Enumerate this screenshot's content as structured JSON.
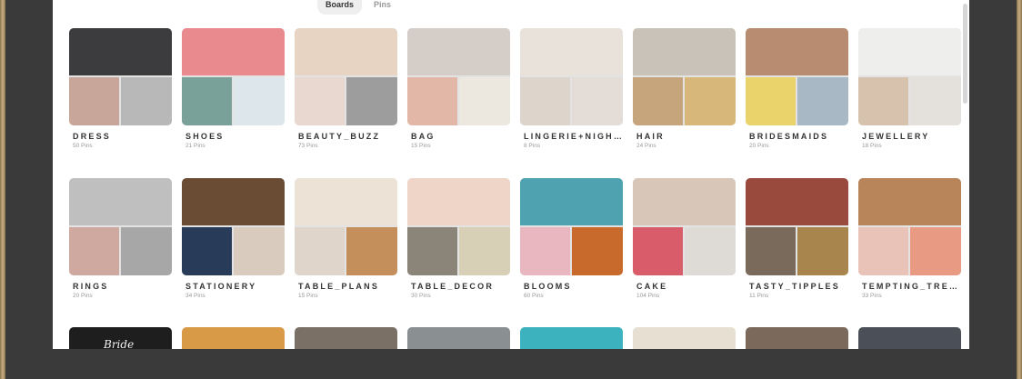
{
  "tabs": [
    {
      "label": "Boards",
      "active": true
    },
    {
      "label": "Pins",
      "active": false
    }
  ],
  "boards": [
    {
      "title": "DRESS",
      "count": "50 Pins",
      "colors": [
        "#3c3c3e",
        "#c9a69a",
        "#b8b8b8"
      ]
    },
    {
      "title": "SHOES",
      "count": "21 Pins",
      "colors": [
        "#e98a8f",
        "#7aa09a",
        "#dde6ea"
      ]
    },
    {
      "title": "BEAUTY_BUZZ",
      "count": "73 Pins",
      "colors": [
        "#e7d4c3",
        "#e8d8cf",
        "#9d9d9d"
      ]
    },
    {
      "title": "BAG",
      "count": "15 Pins",
      "colors": [
        "#d4cdc8",
        "#e2b7a7",
        "#ece7df"
      ]
    },
    {
      "title": "LINGERIE+NIGH…",
      "count": "8 Pins",
      "colors": [
        "#e9e2db",
        "#ddd5cc",
        "#e4ddd7"
      ]
    },
    {
      "title": "HAIR",
      "count": "24 Pins",
      "colors": [
        "#c9c2b9",
        "#c7a57c",
        "#d8b77b"
      ]
    },
    {
      "title": "BRIDESMAIDS",
      "count": "20 Pins",
      "colors": [
        "#b78c71",
        "#e9d36a",
        "#a8b8c4"
      ]
    },
    {
      "title": "JEWELLERY",
      "count": "18 Pins",
      "colors": [
        "#eeeeec",
        "#d7c2ae",
        "#e4e0dc"
      ]
    },
    {
      "title": "RINGS",
      "count": "20 Pins",
      "colors": [
        "#bfbfbf",
        "#cfa8a0",
        "#a7a7a7"
      ]
    },
    {
      "title": "STATIONERY",
      "count": "34 Pins",
      "colors": [
        "#6a4b34",
        "#283b59",
        "#d9cbbe"
      ]
    },
    {
      "title": "TABLE_PLANS",
      "count": "15 Pins",
      "colors": [
        "#ece2d6",
        "#dfd5cb",
        "#c48f5a"
      ]
    },
    {
      "title": "TABLE_DECOR",
      "count": "30 Pins",
      "colors": [
        "#eed5c8",
        "#8b8478",
        "#d8d0b6"
      ]
    },
    {
      "title": "BLOOMS",
      "count": "60 Pins",
      "colors": [
        "#4fa2b0",
        "#e8b7c0",
        "#c86a2c"
      ]
    },
    {
      "title": "CAKE",
      "count": "104 Pins",
      "colors": [
        "#d8c6b8",
        "#d85c6a",
        "#dedad5"
      ]
    },
    {
      "title": "TASTY_TIPPLES",
      "count": "11 Pins",
      "colors": [
        "#9a4a3c",
        "#7a6a5c",
        "#a8854c"
      ]
    },
    {
      "title": "TEMPTING_TRE…",
      "count": "33 Pins",
      "colors": [
        "#b8855a",
        "#e9c3b7",
        "#e89a82"
      ]
    }
  ],
  "partial_row": {
    "bride_text": "Bride",
    "colors": [
      "#1e1e1e",
      "#d99a48",
      "#7a7065",
      "#8a8f91",
      "#3bb2bd",
      "#e7dfd2",
      "#7b6a5c",
      "#4a4f58"
    ]
  },
  "colors": {
    "background": "#3a3a3a",
    "page": "#ffffff",
    "frame": "#c7ae82",
    "active_tab": "#efefef"
  }
}
